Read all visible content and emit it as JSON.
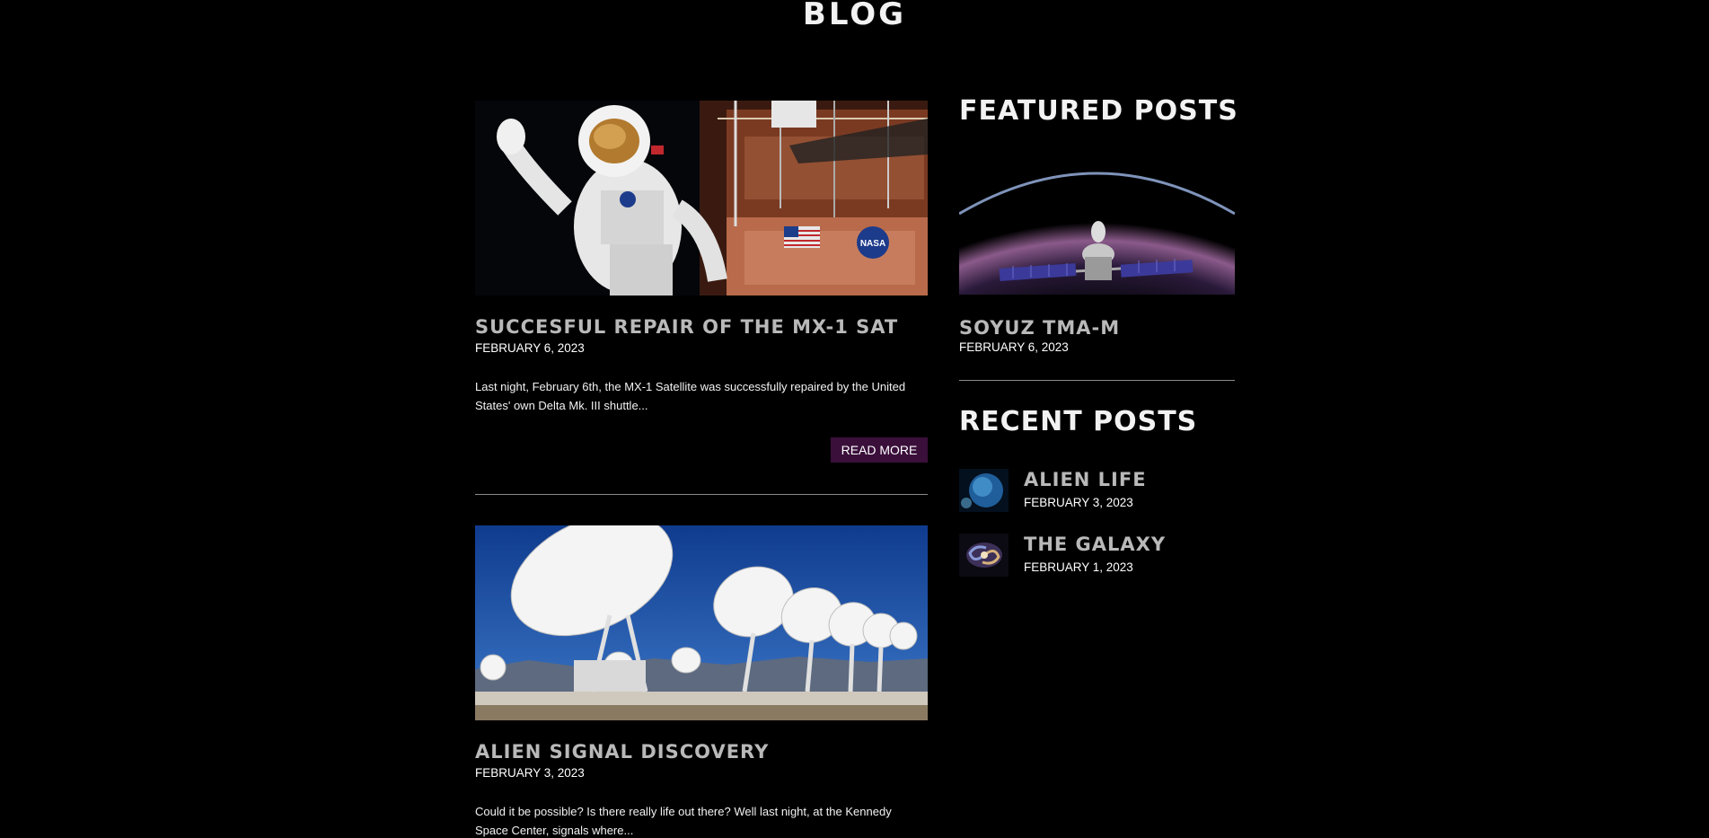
{
  "page": {
    "title": "BLOG"
  },
  "posts": [
    {
      "title": "SUCCESFUL REPAIR OF THE MX-1 SAT",
      "date": "FEBRUARY 6, 2023",
      "excerpt": "Last night, February 6th, the MX-1 Satellite was successfully repaired by the United States' own Delta Mk. III shuttle...",
      "read_more": "READ MORE",
      "image_label": "NASA"
    },
    {
      "title": "ALIEN SIGNAL DISCOVERY",
      "date": "FEBRUARY 3, 2023",
      "excerpt": "Could it be possible? Is there really life out there? Well last night, at the Kennedy Space Center, signals where..."
    }
  ],
  "sidebar": {
    "featured_heading": "FEATURED POSTS",
    "featured": {
      "title": "SOYUZ TMA-M",
      "date": "FEBRUARY 6, 2023"
    },
    "recent_heading": "RECENT POSTS",
    "recent": [
      {
        "title": "ALIEN LIFE",
        "date": "FEBRUARY 3, 2023"
      },
      {
        "title": "THE GALAXY",
        "date": "FEBRUARY 1, 2023"
      }
    ]
  },
  "colors": {
    "background": "#000000",
    "button": "#3a0f3a",
    "title_gray": "#b9b9b9",
    "divider": "#8a8a8a"
  }
}
